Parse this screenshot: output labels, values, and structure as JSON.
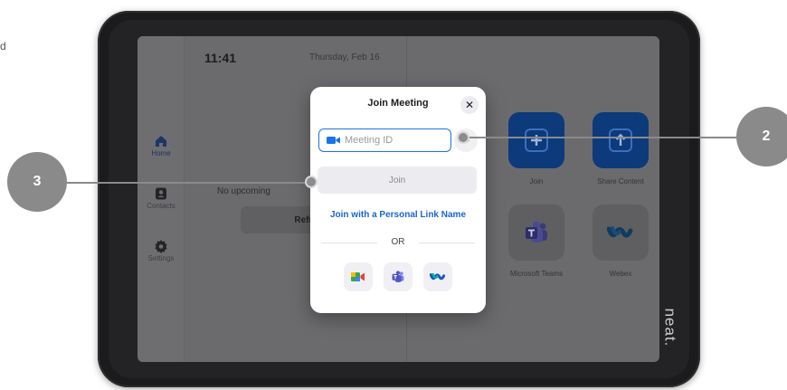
{
  "edge_text": "d",
  "device": {
    "brand": "neat."
  },
  "status": {
    "time": "11:41",
    "date": "Thursday, Feb 16"
  },
  "sidebar": {
    "items": [
      {
        "label": "Home",
        "icon": "home-icon",
        "active": true
      },
      {
        "label": "Contacts",
        "icon": "contacts-icon",
        "active": false
      },
      {
        "label": "Settings",
        "icon": "settings-icon",
        "active": false
      }
    ]
  },
  "calendar": {
    "empty_text": "No upcoming",
    "refresh_label": "Refres"
  },
  "apps": [
    {
      "label": "Join",
      "icon": "join-plus-icon"
    },
    {
      "label": "Share Content",
      "icon": "share-content-icon"
    },
    {
      "label": "Microsoft Teams",
      "icon": "teams-icon"
    },
    {
      "label": "Webex",
      "icon": "webex-icon"
    }
  ],
  "modal": {
    "title": "Join Meeting",
    "close_symbol": "✕",
    "meeting_id_placeholder": "Meeting ID",
    "join_label": "Join",
    "personal_link_label": "Join with a Personal Link Name",
    "or_label": "OR",
    "services": [
      "google-meet-icon",
      "teams-icon",
      "webex-icon"
    ]
  },
  "callouts": [
    {
      "number": "2"
    },
    {
      "number": "3"
    }
  ],
  "colors": {
    "accent": "#1a74e8",
    "link": "#1a64d0",
    "app_blue": "#0c3a7a",
    "callout": "#8a8a8a"
  }
}
